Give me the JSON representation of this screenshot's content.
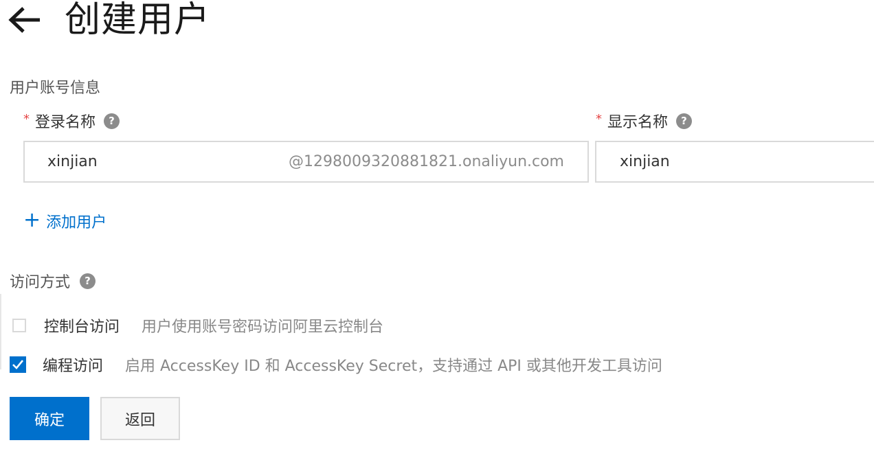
{
  "header": {
    "title": "创建用户",
    "back_icon": "arrow-left-icon"
  },
  "account_section": {
    "title": "用户账号信息"
  },
  "login_name": {
    "label": "登录名称",
    "required_mark": "*",
    "help": "?",
    "value": "xinjian",
    "suffix": "@1298009320881821.onaliyun.com"
  },
  "display_name": {
    "label": "显示名称",
    "required_mark": "*",
    "help": "?",
    "value": "xinjian"
  },
  "add_user": {
    "plus": "+",
    "label": "添加用户"
  },
  "access_section": {
    "title": "访问方式",
    "help": "?"
  },
  "access_options": [
    {
      "label": "控制台访问",
      "description": "用户使用账号密码访问阿里云控制台",
      "checked": false
    },
    {
      "label": "编程访问",
      "description": "启用 AccessKey ID 和 AccessKey Secret，支持通过 API 或其他开发工具访问",
      "checked": true
    }
  ],
  "buttons": {
    "confirm": "确定",
    "back": "返回"
  },
  "colors": {
    "primary": "#0070cc",
    "required": "#e54545",
    "help_icon": "#8c8c8c"
  }
}
